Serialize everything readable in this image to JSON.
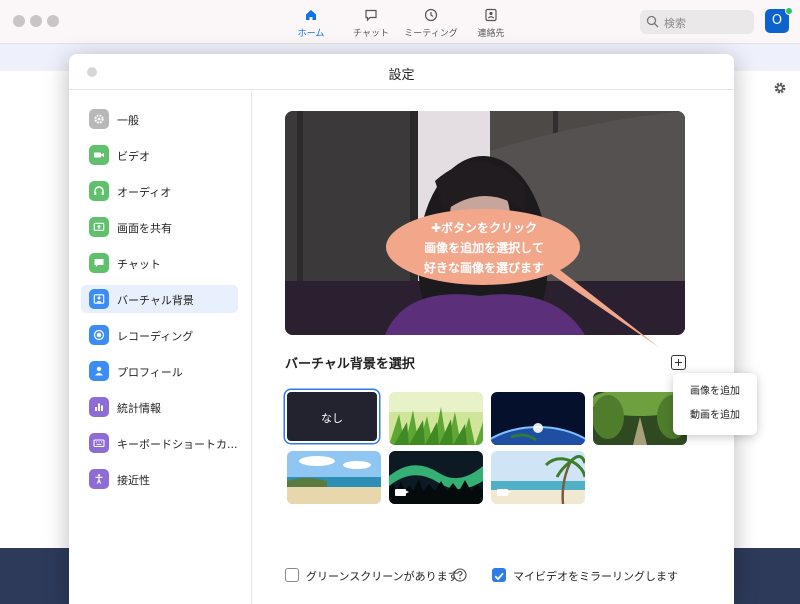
{
  "titlebar": {
    "nav": [
      {
        "label": "ホーム",
        "icon": "home-icon",
        "active": true
      },
      {
        "label": "チャット",
        "icon": "chat-bubble-icon",
        "active": false
      },
      {
        "label": "ミーティング",
        "icon": "clock-icon",
        "active": false
      },
      {
        "label": "連絡先",
        "icon": "contact-card-icon",
        "active": false
      }
    ],
    "search_placeholder": "検索",
    "avatar_initial": "O"
  },
  "dialog": {
    "title": "設定",
    "sidebar": [
      {
        "label": "一般",
        "icon": "gear-icon",
        "color": "#b8b8b8"
      },
      {
        "label": "ビデオ",
        "icon": "video-camera-icon",
        "color": "#5fc16b"
      },
      {
        "label": "オーディオ",
        "icon": "headphones-icon",
        "color": "#5fc16b"
      },
      {
        "label": "画面を共有",
        "icon": "share-screen-icon",
        "color": "#5fc16b"
      },
      {
        "label": "チャット",
        "icon": "chat-icon",
        "color": "#5fc16b"
      },
      {
        "label": "バーチャル背景",
        "icon": "person-background-icon",
        "color": "#3b8df5",
        "active": true
      },
      {
        "label": "レコーディング",
        "icon": "record-icon",
        "color": "#3b8df5"
      },
      {
        "label": "プロフィール",
        "icon": "profile-icon",
        "color": "#3b8df5"
      },
      {
        "label": "統計情報",
        "icon": "statistics-icon",
        "color": "#8d6cd6"
      },
      {
        "label": "キーボードショートカ...",
        "icon": "keyboard-icon",
        "color": "#8d6cd6"
      },
      {
        "label": "接近性",
        "icon": "accessibility-icon",
        "color": "#8d6cd6"
      }
    ],
    "section_title": "バーチャル背景を選択",
    "backgrounds": [
      {
        "label": "なし",
        "type": "none",
        "selected": true
      },
      {
        "label": "",
        "type": "grass"
      },
      {
        "label": "",
        "type": "earth"
      },
      {
        "label": "",
        "type": "forest"
      },
      {
        "label": "",
        "type": "beach"
      },
      {
        "label": "",
        "type": "aurora",
        "video": true
      },
      {
        "label": "",
        "type": "palm",
        "video": true
      }
    ],
    "add_menu": [
      "画像を追加",
      "動画を追加"
    ],
    "callout": [
      "✚ボタンをクリック",
      "画像を追加を選択して",
      "好きな画像を選びます"
    ],
    "green_screen_label": "グリーンスクリーンがあります",
    "green_screen_checked": false,
    "mirror_label": "マイビデオをミラーリングします",
    "mirror_checked": true
  },
  "colors": {
    "accent": "#0e71eb",
    "callout": "#f2a68a",
    "active_item": "#e8f0fd"
  }
}
